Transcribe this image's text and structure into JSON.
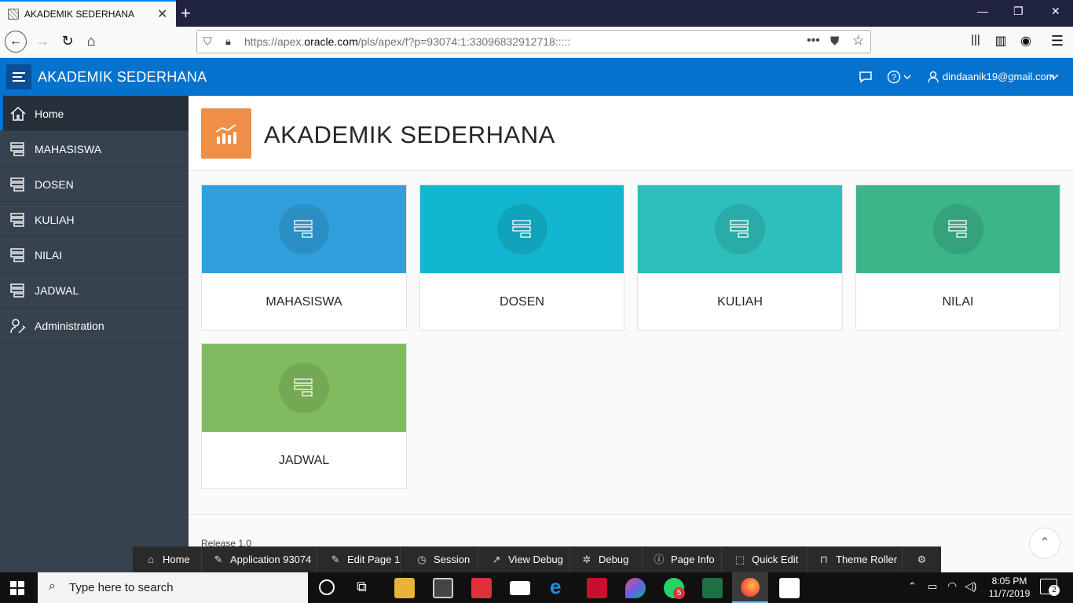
{
  "browser": {
    "tab_title": "AKADEMIK SEDERHANA",
    "url_prefix": "https://apex.",
    "url_domain": "oracle.com",
    "url_path": "/pls/apex/f?p=93074:1:33096832912718:::::"
  },
  "header": {
    "app_title": "AKADEMIK SEDERHANA",
    "user_email": "dindaanik19@gmail.com"
  },
  "sidebar": {
    "items": [
      {
        "label": "Home",
        "icon": "home-icon"
      },
      {
        "label": "MAHASISWA",
        "icon": "list-icon"
      },
      {
        "label": "DOSEN",
        "icon": "list-icon"
      },
      {
        "label": "KULIAH",
        "icon": "list-icon"
      },
      {
        "label": "NILAI",
        "icon": "list-icon"
      },
      {
        "label": "JADWAL",
        "icon": "list-icon"
      },
      {
        "label": "Administration",
        "icon": "user-wrench-icon"
      }
    ]
  },
  "hero": {
    "title": "AKADEMIK SEDERHANA",
    "icon": "chart-icon"
  },
  "cards": [
    {
      "label": "MAHASISWA",
      "color": "#309fdb"
    },
    {
      "label": "DOSEN",
      "color": "#13b6cf"
    },
    {
      "label": "KULIAH",
      "color": "#2ebfbc"
    },
    {
      "label": "NILAI",
      "color": "#3cb589"
    },
    {
      "label": "JADWAL",
      "color": "#81bb5f"
    }
  ],
  "footer": {
    "release": "Release 1.0"
  },
  "dev_toolbar": {
    "items": [
      "Home",
      "Application 93074",
      "Edit Page 1",
      "Session",
      "View Debug",
      "Debug",
      "Page Info",
      "Quick Edit",
      "Theme Roller"
    ]
  },
  "taskbar": {
    "search_placeholder": "Type here to search",
    "time": "8:05 PM",
    "date": "11/7/2019",
    "whatsapp_badge": "5",
    "notification_count": "2"
  },
  "colors": {
    "apex_blue": "#0572ce",
    "sidebar": "#36424d",
    "hero_icon": "#ef8f47"
  }
}
